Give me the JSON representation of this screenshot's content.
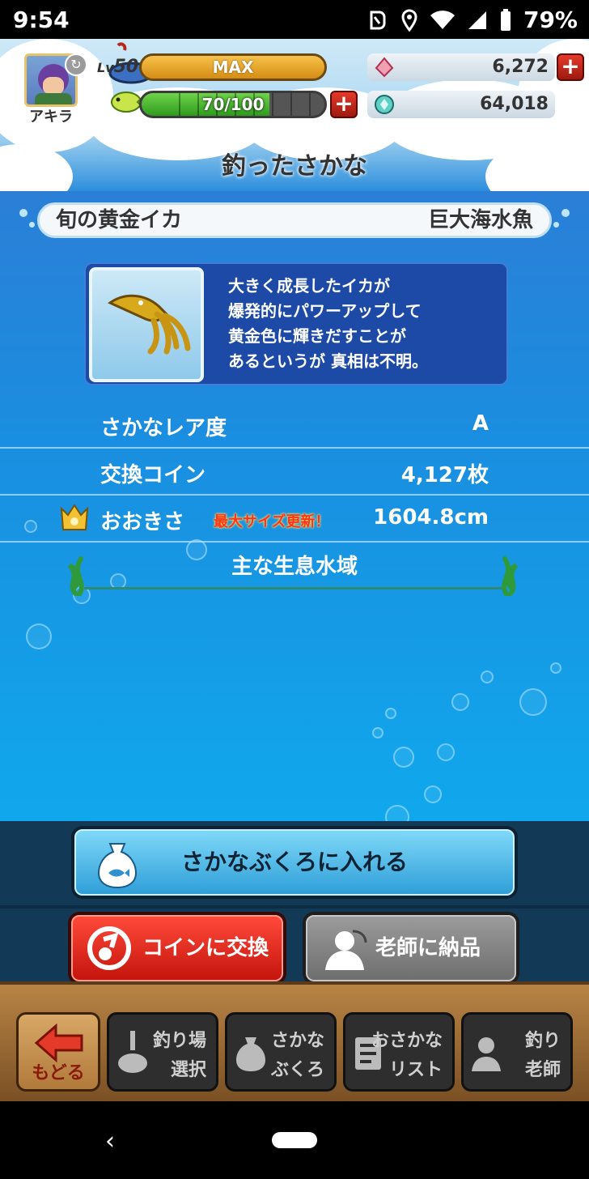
{
  "status_bar": {
    "time": "9:54",
    "battery": "79%"
  },
  "hud": {
    "character_name": "アキラ",
    "level_prefix": "Lv",
    "level": "50",
    "exp_label": "MAX",
    "stamina": "70/100",
    "stamina_fraction": 0.7,
    "gems": "6,272",
    "coins": "64,018"
  },
  "page_title": "釣ったさかな",
  "fish": {
    "name": "旬の黄金イカ",
    "category": "巨大海水魚",
    "description": [
      "大きく成長したイカが",
      "爆発的にパワーアップして",
      "黄金色に輝きだすことが",
      "あるというが 真相は不明。"
    ],
    "rarity_label": "さかなレア度",
    "rarity_value": "A",
    "coin_label": "交換コイン",
    "coin_value": "4,127枚",
    "size_label": "おおきさ",
    "size_badge": "最大サイズ更新！",
    "size_value": "1604.8cm",
    "habitat_label": "主な生息水域"
  },
  "actions": {
    "bag_button": "さかなぶくろに入れる",
    "exchange_button": "コインに交換",
    "deliver_button": "老師に納品"
  },
  "nav": {
    "back": "もどる",
    "items": [
      {
        "line1": "釣り場",
        "line2": "選択"
      },
      {
        "line1": "さかな",
        "line2": "ぶくろ"
      },
      {
        "line1": "おさかな",
        "line2": "リスト"
      },
      {
        "line1": "釣り",
        "line2": "老師"
      }
    ]
  },
  "colors": {
    "accent_red": "#e43a2a",
    "sea_blue": "#1a8ee0",
    "gold": "#f6c24b"
  }
}
